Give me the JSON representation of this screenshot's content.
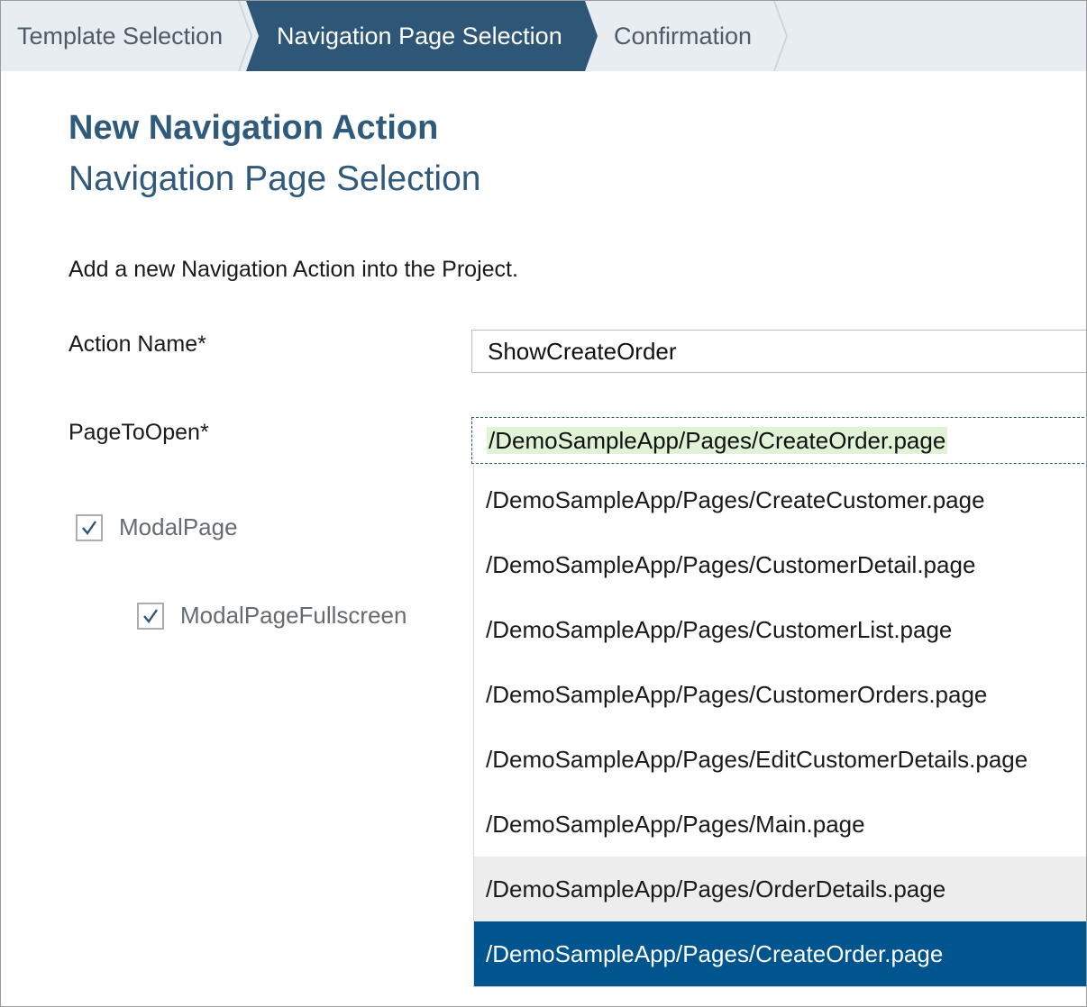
{
  "wizard": {
    "steps": [
      {
        "label": "Template Selection"
      },
      {
        "label": "Navigation Page Selection"
      },
      {
        "label": "Confirmation"
      }
    ]
  },
  "form": {
    "title": "New Navigation Action",
    "subtitle": "Navigation Page Selection",
    "description": "Add a new Navigation Action into the Project.",
    "action_name_label": "Action Name*",
    "action_name_value": "ShowCreateOrder",
    "page_label": "PageToOpen*",
    "page_value": "/DemoSampleApp/Pages/CreateOrder.page",
    "modal_page_label": "ModalPage",
    "modal_page_checked": true,
    "modal_fullscreen_label": "ModalPageFullscreen",
    "modal_fullscreen_checked": true
  },
  "dropdown": {
    "options": [
      {
        "label": "/DemoSampleApp/Pages/CreateCustomer.page"
      },
      {
        "label": "/DemoSampleApp/Pages/CustomerDetail.page"
      },
      {
        "label": "/DemoSampleApp/Pages/CustomerList.page"
      },
      {
        "label": "/DemoSampleApp/Pages/CustomerOrders.page"
      },
      {
        "label": "/DemoSampleApp/Pages/EditCustomerDetails.page"
      },
      {
        "label": "/DemoSampleApp/Pages/Main.page"
      },
      {
        "label": "/DemoSampleApp/Pages/OrderDetails.page",
        "state": "hover"
      },
      {
        "label": "/DemoSampleApp/Pages/CreateOrder.page",
        "state": "selected"
      }
    ]
  },
  "colors": {
    "active_step": "#2e5677",
    "heading": "#2f5a7c",
    "selected_option": "#00558e",
    "hover_option": "#ededed"
  }
}
